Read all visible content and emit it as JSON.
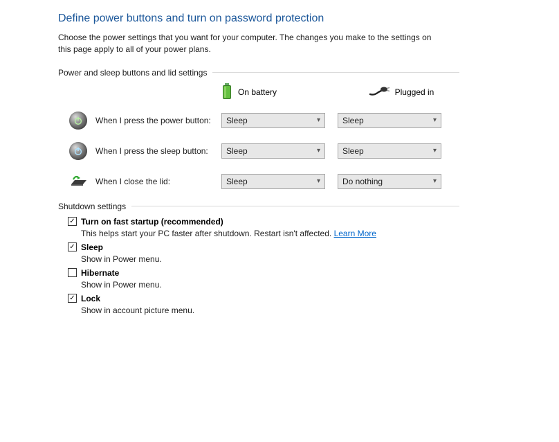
{
  "title": "Define power buttons and turn on password protection",
  "intro": "Choose the power settings that you want for your computer. The changes you make to the settings on this page apply to all of your power plans.",
  "section1": {
    "heading": "Power and sleep buttons and lid settings",
    "col_battery": "On battery",
    "col_plugged": "Plugged in",
    "rows": [
      {
        "label": "When I press the power button:",
        "battery": "Sleep",
        "plugged": "Sleep"
      },
      {
        "label": "When I press the sleep button:",
        "battery": "Sleep",
        "plugged": "Sleep"
      },
      {
        "label": "When I close the lid:",
        "battery": "Sleep",
        "plugged": "Do nothing"
      }
    ]
  },
  "section2": {
    "heading": "Shutdown settings",
    "items": [
      {
        "checked": true,
        "label": "Turn on fast startup (recommended)",
        "desc": "This helps start your PC faster after shutdown. Restart isn't affected. ",
        "learn": "Learn More"
      },
      {
        "checked": true,
        "label": "Sleep",
        "desc": "Show in Power menu."
      },
      {
        "checked": false,
        "label": "Hibernate",
        "desc": "Show in Power menu."
      },
      {
        "checked": true,
        "label": "Lock",
        "desc": "Show in account picture menu."
      }
    ]
  }
}
